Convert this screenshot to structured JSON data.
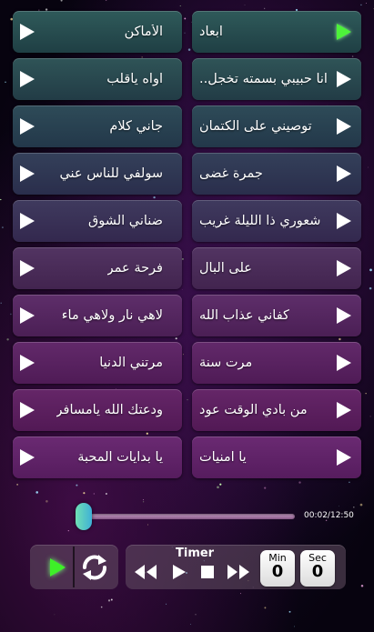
{
  "songs": [
    {
      "label": "الأماكن",
      "icon": "play-icon"
    },
    {
      "label": "ابعاد",
      "icon": "play-icon",
      "active": true
    },
    {
      "label": "اواه ياقلب",
      "icon": "play-icon"
    },
    {
      "label": "انا حبيبي بسمته تخجل..",
      "icon": "play-icon"
    },
    {
      "label": "جاني كلام",
      "icon": "play-icon"
    },
    {
      "label": "توصيني على الكتمان",
      "icon": "play-icon"
    },
    {
      "label": "سولفي للناس عني",
      "icon": "play-icon"
    },
    {
      "label": "جمرة غضى",
      "icon": "play-icon"
    },
    {
      "label": "ضناني الشوق",
      "icon": "play-icon"
    },
    {
      "label": "شعوري ذا الليلة غريب",
      "icon": "play-icon"
    },
    {
      "label": "فرحة عمر",
      "icon": "play-icon"
    },
    {
      "label": "على البال",
      "icon": "play-icon"
    },
    {
      "label": "لاهي نار ولاهي ماء",
      "icon": "play-icon"
    },
    {
      "label": "كفاني عذاب الله",
      "icon": "play-icon"
    },
    {
      "label": "مرتني الدنيا",
      "icon": "play-icon"
    },
    {
      "label": "مرت سنة",
      "icon": "play-icon"
    },
    {
      "label": "ودعتك الله يامسافر",
      "icon": "play-icon"
    },
    {
      "label": "من بادي الوقت عود",
      "icon": "play-icon"
    },
    {
      "label": "يا بدايات المحبة",
      "icon": "play-icon"
    },
    {
      "label": "يا امنيات",
      "icon": "play-icon"
    }
  ],
  "player": {
    "time": "00:02/12:50",
    "progress_fraction": 0.003
  },
  "controls": {
    "play_icon": "play-icon",
    "repeat_icon": "repeat-icon"
  },
  "timer": {
    "title": "Timer",
    "min_label": "Min",
    "min_value": "0",
    "sec_label": "Sec",
    "sec_value": "0"
  },
  "colors": {
    "active_play": "#4df23a",
    "seek_thumb": "#5fd0c0"
  }
}
